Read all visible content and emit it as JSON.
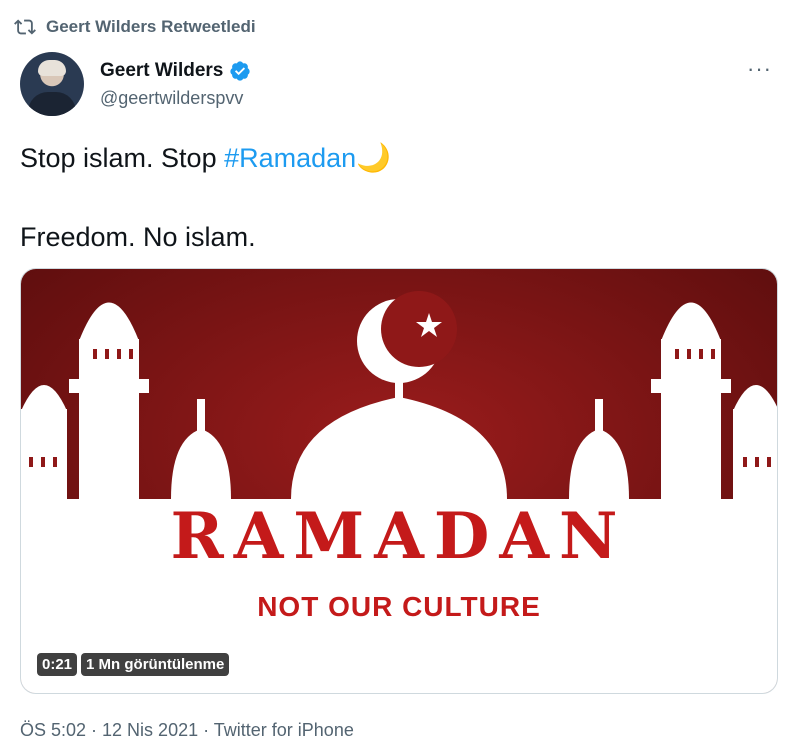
{
  "retweet": {
    "label": "Geert Wilders Retweetledi"
  },
  "author": {
    "name": "Geert Wilders",
    "handle": "@geertwilderspvv"
  },
  "tweet": {
    "text_part1": "Stop islam. Stop ",
    "hashtag": "#Ramadan",
    "emoji": "🌙",
    "line2": "Freedom. No islam."
  },
  "media": {
    "title": "RAMADAN",
    "subtitle": "NOT OUR CULTURE",
    "duration": "0:21",
    "views": "1 Mn görüntülenme"
  },
  "meta": {
    "timestamp": "ÖS 5:02 · 12 Nis 2021 · Twitter for iPhone"
  },
  "colors": {
    "accent": "#1d9bf0",
    "media_red": "#8b1414",
    "text_red": "#c41a1a"
  }
}
